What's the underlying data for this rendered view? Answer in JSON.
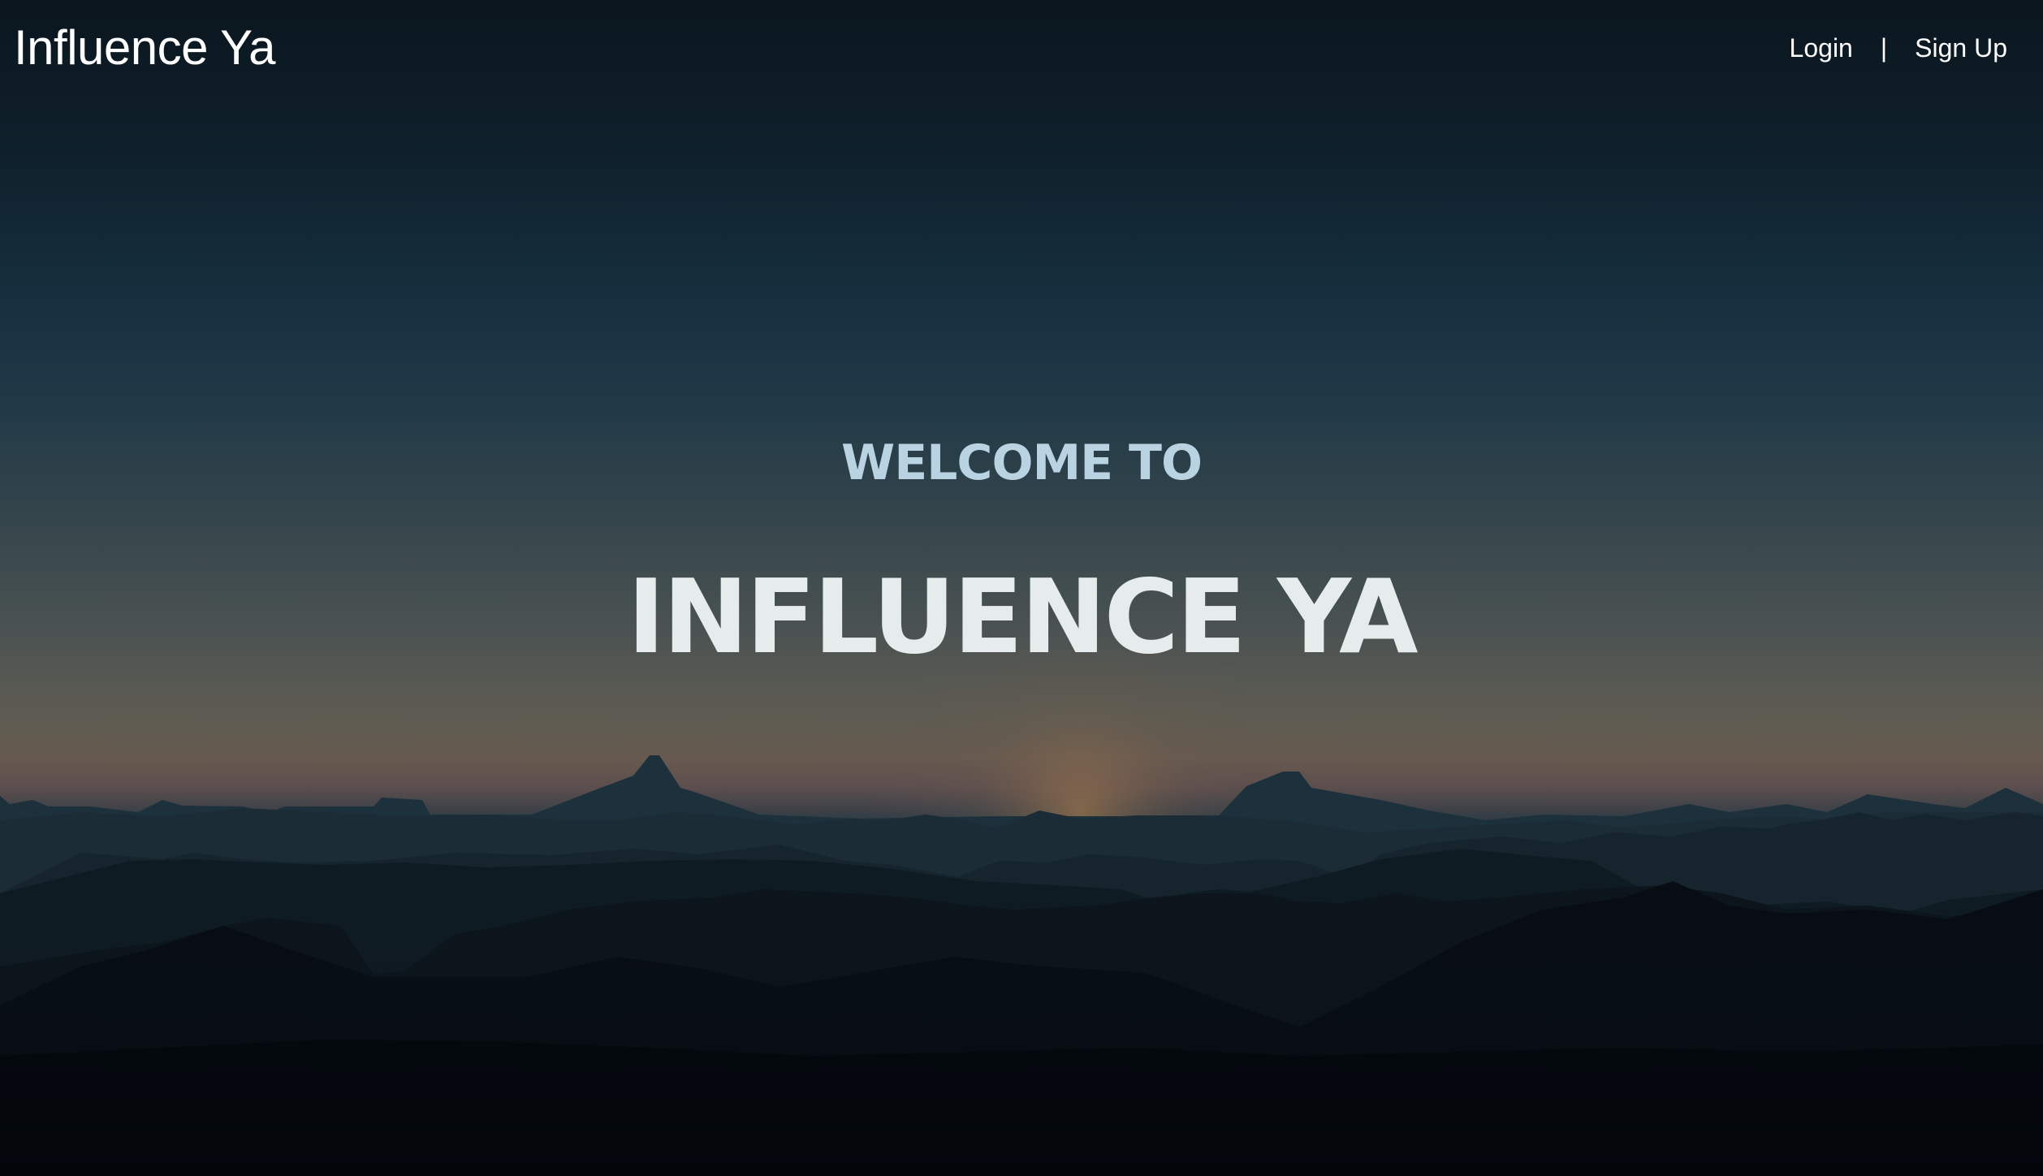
{
  "header": {
    "brand": "Influence Ya",
    "nav": {
      "login_label": "Login",
      "separator": "|",
      "signup_label": "Sign Up"
    }
  },
  "hero": {
    "kicker": "WELCOME TO",
    "title": "INFLUENCE YA"
  },
  "colors": {
    "text_primary": "#ffffff",
    "kicker": "#b9d3e3",
    "title": "#e6ecec",
    "sky_top": "#0b161e",
    "horizon_glow": "#675a4f",
    "foreground": "#03060b"
  }
}
